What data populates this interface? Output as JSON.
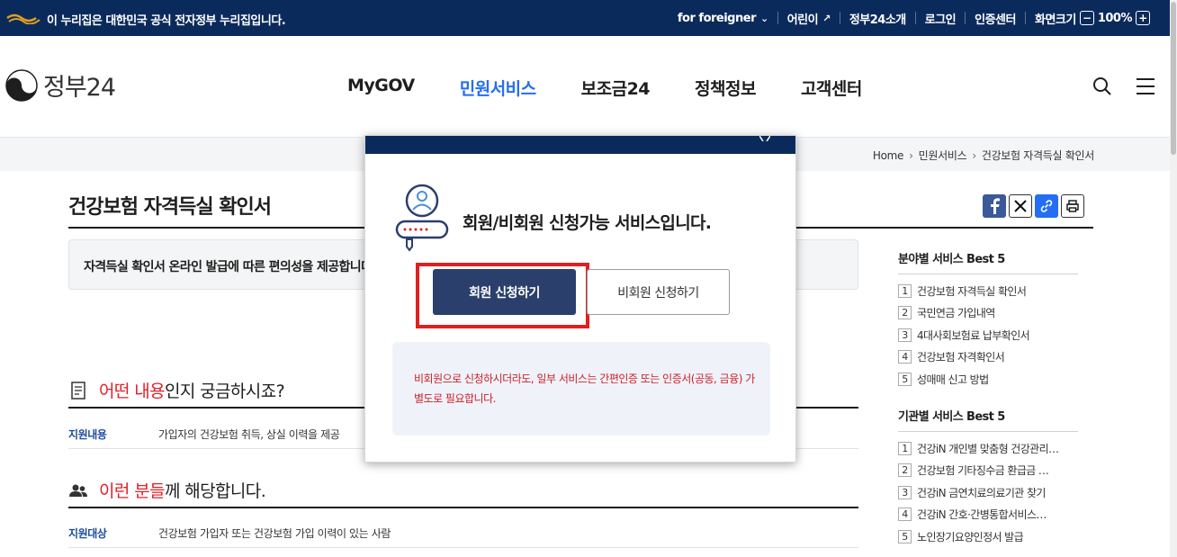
{
  "topbar": {
    "gov_notice": "이 누리집은 대한민국 공식 전자정부 누리집입니다.",
    "links": {
      "foreigner": "for foreigner",
      "kids": "어린이",
      "about": "정부24소개",
      "login": "로그인",
      "cert": "인증센터",
      "zoom_label": "화면크기",
      "zoom_value": "100%"
    }
  },
  "header": {
    "logo_text": "정부24",
    "nav": [
      "MyGOV",
      "민원서비스",
      "보조금24",
      "정책정보",
      "고객센터"
    ],
    "active_nav": "민원서비스"
  },
  "breadcrumb": [
    "Home",
    "민원서비스",
    "건강보험 자격득실 확인서"
  ],
  "page": {
    "title": "건강보험 자격득실 확인서",
    "summary": "자격득실 확인서 온라인 발급에 따른 편의성을 제공합니다.",
    "section1": {
      "highlight": "어떤 내용",
      "rest": "인지 궁금하시죠?"
    },
    "support_content_label": "지원내용",
    "support_content_value": "가입자의 건강보험 취득, 상실 이력을 제공",
    "section2": {
      "highlight": "이런 분들",
      "rest": "께 해당합니다."
    },
    "target_label": "지원대상",
    "target_value": "건강보험 가입자 또는 건강보험 가입 이력이 있는 사람"
  },
  "side": {
    "field_best_title": "분야별 서비스 Best 5",
    "field_best": [
      "건강보험 자격득실 확인서",
      "국민연금 가입내역",
      "4대사회보험료 납부확인서",
      "건강보험 자격확인서",
      "성매매 신고 방법"
    ],
    "agency_best_title": "기관별 서비스 Best 5",
    "agency_best": [
      "건강iN 개인별 맞춤형 건강관리…",
      "건강보험 기타징수금 환급금 …",
      "건강iN 금연치료의료기관 찾기",
      "건강iN 간호·간병통합서비스…",
      "노인장기요양인정서 발급"
    ]
  },
  "modal": {
    "title": "회원/비회원 신청가능 서비스입니다.",
    "member_button": "회원 신청하기",
    "guest_button": "비회원 신청하기",
    "notice": "비회원으로 신청하시더라도, 일부 서비스는 간편인증 또는 인증서(공동, 금융) 가 별도로 필요합니다."
  },
  "colors": {
    "topbar_bg": "#0b2a5c",
    "active_nav": "#256ef4",
    "member_button": "#2b3f6c",
    "highlight_red": "#e0202a",
    "focus_box": "#e01f1f"
  }
}
